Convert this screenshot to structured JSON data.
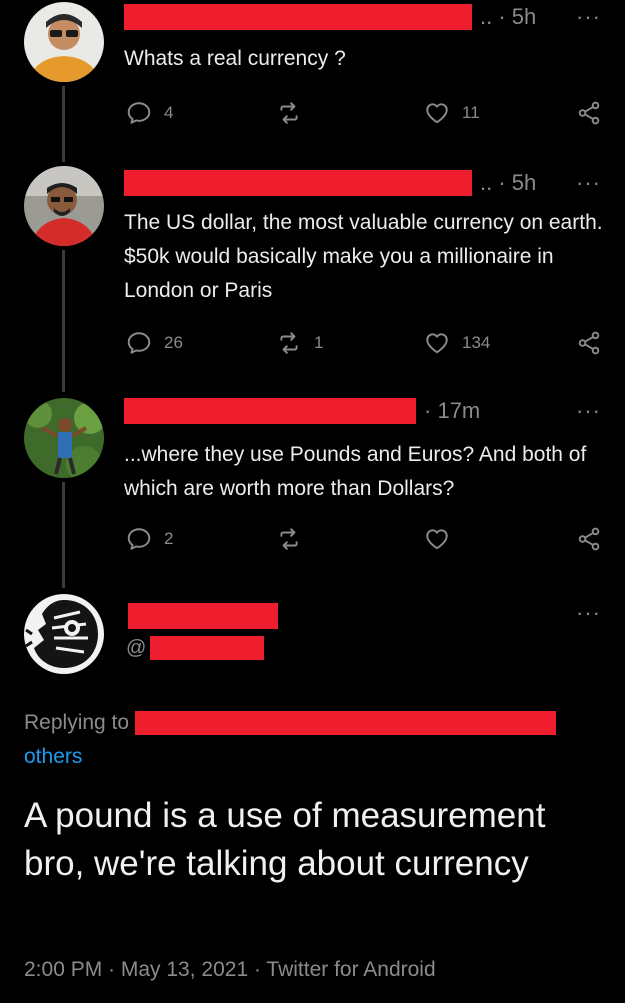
{
  "thread": [
    {
      "time": "5h",
      "text": "Whats a real currency ?",
      "replies": "4",
      "retweets": "",
      "likes": "11"
    },
    {
      "time": "5h",
      "text": "The US dollar, the most valuable currency on earth. $50k would basically make you a millionaire in London or Paris",
      "replies": "26",
      "retweets": "1",
      "likes": "134"
    },
    {
      "time": "17m",
      "text": "...where they use Pounds and Euros? And both of which are worth more than Dollars?",
      "replies": "2",
      "retweets": "",
      "likes": ""
    }
  ],
  "main_tweet": {
    "handle_prefix": "@",
    "replying_prefix": "Replying to",
    "replying_others": "others",
    "text": "A pound is a use of measurement bro, we're talking about currency",
    "footer": "2:00 PM · May 13, 2021 · Twitter for Android"
  },
  "more_glyph": "···",
  "meta_dot": "·",
  "colors": {
    "background": "#000000",
    "text": "#e7e9ea",
    "muted": "#8b8b8b",
    "link": "#1d9bf0",
    "redaction": "#ef1e2e"
  }
}
